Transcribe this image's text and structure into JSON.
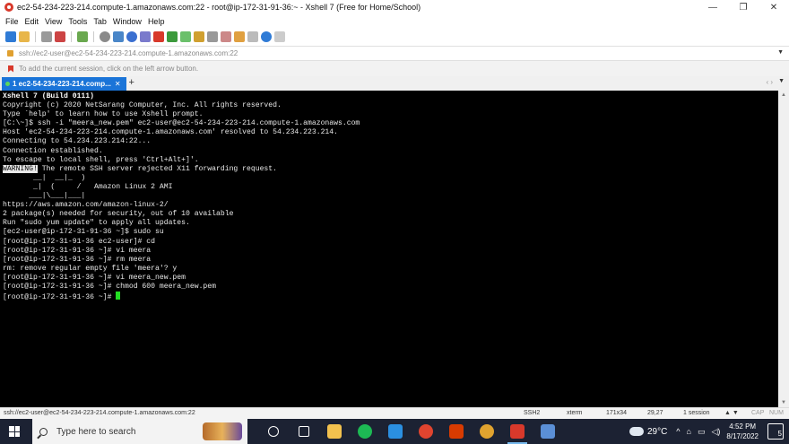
{
  "window": {
    "title": "ec2-54-234-223-214.compute-1.amazonaws.com:22 - root@ip-172-31-91-36:~ - Xshell 7 (Free for Home/School)",
    "minimize": "—",
    "maximize": "❐",
    "close": "✕"
  },
  "menu": [
    "File",
    "Edit",
    "View",
    "Tools",
    "Tab",
    "Window",
    "Help"
  ],
  "address": {
    "value": "ssh://ec2-user@ec2-54-234-223-214.compute-1.amazonaws.com:22",
    "dropdown": "▼"
  },
  "hint": "To add the current session, click on the left arrow button.",
  "tabs": {
    "active_label": "1 ec2-54-234-223-214.comp...",
    "close": "✕",
    "add": "+",
    "nav": "‹ ›",
    "menu": "▼"
  },
  "terminal": {
    "lines": [
      {
        "text": "Xshell 7 (Build 0111)",
        "bold": true
      },
      {
        "text": "Copyright (c) 2020 NetSarang Computer, Inc. All rights reserved."
      },
      {
        "text": ""
      },
      {
        "text": "Type `help' to learn how to use Xshell prompt."
      },
      {
        "text": "[C:\\~]$ ssh -i \"meera_new.pem\" ec2-user@ec2-54-234-223-214.compute-1.amazonaws.com"
      },
      {
        "text": ""
      },
      {
        "text": ""
      },
      {
        "text": "Host 'ec2-54-234-223-214.compute-1.amazonaws.com' resolved to 54.234.223.214."
      },
      {
        "text": "Connecting to 54.234.223.214:22..."
      },
      {
        "text": "Connection established."
      },
      {
        "text": "To escape to local shell, press 'Ctrl+Alt+]'."
      },
      {
        "text": ""
      },
      {
        "warn": "WARNING!",
        "text": " The remote SSH server rejected X11 forwarding request."
      },
      {
        "text": ""
      },
      {
        "text": "       __|  __|_  )"
      },
      {
        "text": "       _|  (     /   Amazon Linux 2 AMI"
      },
      {
        "text": "      ___|\\___|___|"
      },
      {
        "text": ""
      },
      {
        "text": "https://aws.amazon.com/amazon-linux-2/"
      },
      {
        "text": "2 package(s) needed for security, out of 10 available"
      },
      {
        "text": "Run \"sudo yum update\" to apply all updates."
      },
      {
        "text": "[ec2-user@ip-172-31-91-36 ~]$ sudo su"
      },
      {
        "text": "[root@ip-172-31-91-36 ec2-user]# cd"
      },
      {
        "text": "[root@ip-172-31-91-36 ~]# vi meera"
      },
      {
        "text": "[root@ip-172-31-91-36 ~]# rm meera"
      },
      {
        "text": "rm: remove regular empty file 'meera'? y"
      },
      {
        "text": "[root@ip-172-31-91-36 ~]# vi meera_new.pem"
      },
      {
        "text": "[root@ip-172-31-91-36 ~]# chmod 600 meera_new.pem"
      },
      {
        "text": "[root@ip-172-31-91-36 ~]# ",
        "cursor": true
      }
    ],
    "cursor_color": "#22dd22"
  },
  "status": {
    "connection": "ssh://ec2-user@ec2-54-234-223-214.compute-1.amazonaws.com:22",
    "protocol": "SSH2",
    "terminal_type": "xterm",
    "size": "171x34",
    "position": "29,27",
    "sessions": "1 session",
    "caps": "CAP",
    "num": "NUM",
    "arrows": "▲ ▼"
  },
  "taskbar": {
    "search_placeholder": "Type here to search",
    "weather_temp": "29°C",
    "time": "4:52 PM",
    "date": "8/17/2022",
    "notifications": "5",
    "tray_icons": [
      "^",
      "⌂",
      "▭",
      "◁)"
    ],
    "apps": [
      {
        "name": "task-view",
        "color": "#ffffff"
      },
      {
        "name": "widgets",
        "color": "#ffffff"
      },
      {
        "name": "file-explorer",
        "color": "#f2c14e"
      },
      {
        "name": "spotify",
        "color": "#1db954"
      },
      {
        "name": "vscode",
        "color": "#2b8fe0"
      },
      {
        "name": "chrome",
        "color": "#e0442f"
      },
      {
        "name": "office",
        "color": "#d83b01"
      },
      {
        "name": "chrome-alt",
        "color": "#e0a32f"
      },
      {
        "name": "xshell",
        "color": "#d8392b"
      },
      {
        "name": "notes",
        "color": "#5b8fd6"
      }
    ]
  },
  "colors": {
    "tab_active": "#1a74d8",
    "terminal_bg": "#000000",
    "taskbar_bg": "#1c2233"
  }
}
